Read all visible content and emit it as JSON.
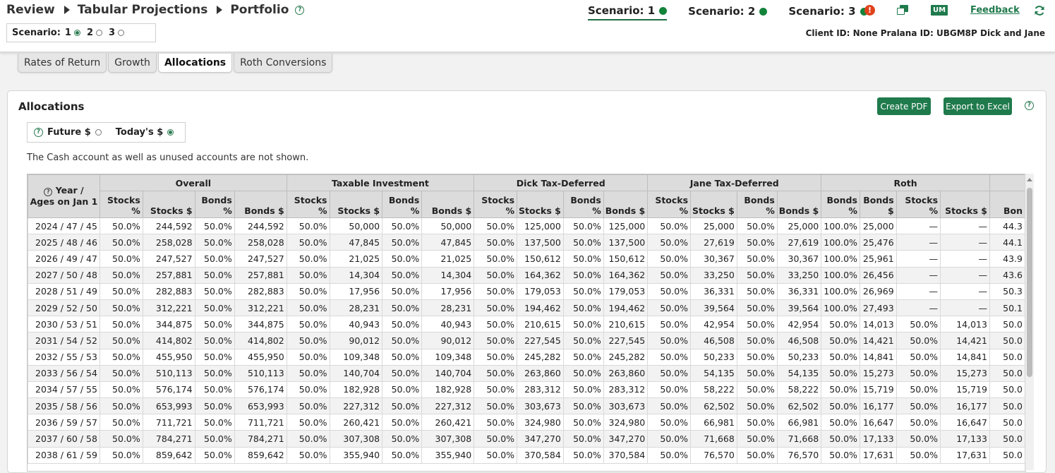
{
  "breadcrumb": {
    "items": [
      "Review",
      "Tabular Projections",
      "Portfolio"
    ]
  },
  "scenario_select": {
    "label": "Scenario:",
    "options": [
      "1",
      "2",
      "3"
    ],
    "selected": "1"
  },
  "scenario_tabs": [
    {
      "label": "Scenario: 1",
      "status_color": "#13843a",
      "active": true
    },
    {
      "label": "Scenario: 2",
      "status_color": "#13843a",
      "active": false
    },
    {
      "label": "Scenario: 3",
      "status_color": "#13843a",
      "active": false
    }
  ],
  "header": {
    "alert_glyph": "!",
    "user_badge": "UM",
    "feedback_label": "Feedback",
    "client_info": "Client ID: None  Pralana ID: UBGM8P  Dick and Jane"
  },
  "page_tabs": [
    {
      "label": "Rates of Return",
      "active": false
    },
    {
      "label": "Growth",
      "active": false
    },
    {
      "label": "Allocations",
      "active": true
    },
    {
      "label": "Roth Conversions",
      "active": false
    }
  ],
  "panel": {
    "title": "Allocations",
    "create_pdf_label": "Create PDF",
    "export_label": "Export to Excel",
    "dollar_options": [
      {
        "label": "Future $",
        "selected": false
      },
      {
        "label": "Today's $",
        "selected": true
      }
    ],
    "note": "The Cash account as well as unused accounts are not shown."
  },
  "table": {
    "year_header": [
      "Year /",
      "Ages on Jan 1"
    ],
    "groups": [
      "Overall",
      "Taxable Investment",
      "Dick Tax-Deferred",
      "Jane Tax-Deferred",
      "Roth",
      ""
    ],
    "subheaders": [
      [
        "Stocks",
        "%"
      ],
      [
        "Stocks $"
      ],
      [
        "Bonds",
        "%"
      ],
      [
        "Bonds $"
      ],
      [
        "Stocks",
        "%"
      ],
      [
        "Stocks $"
      ],
      [
        "Bonds",
        "%"
      ],
      [
        "Bonds $"
      ],
      [
        "Stocks",
        "%"
      ],
      [
        "Stocks $"
      ],
      [
        "Bonds",
        "%"
      ],
      [
        "Bonds $"
      ],
      [
        "Stocks",
        "%"
      ],
      [
        "Stocks $"
      ],
      [
        "Bonds",
        "%"
      ],
      [
        "Bonds $"
      ],
      [
        "Bonds",
        "%"
      ],
      [
        "Bonds",
        "$"
      ],
      [
        "Stocks",
        "%"
      ],
      [
        "Stocks $"
      ],
      [
        "Bon"
      ]
    ],
    "rows": [
      [
        "2024 / 47 / 45",
        "50.0%",
        "244,592",
        "50.0%",
        "244,592",
        "50.0%",
        "50,000",
        "50.0%",
        "50,000",
        "50.0%",
        "125,000",
        "50.0%",
        "125,000",
        "50.0%",
        "25,000",
        "50.0%",
        "25,000",
        "100.0%",
        "25,000",
        "—",
        "—",
        "44.3"
      ],
      [
        "2025 / 48 / 46",
        "50.0%",
        "258,028",
        "50.0%",
        "258,028",
        "50.0%",
        "47,845",
        "50.0%",
        "47,845",
        "50.0%",
        "137,500",
        "50.0%",
        "137,500",
        "50.0%",
        "27,619",
        "50.0%",
        "27,619",
        "100.0%",
        "25,476",
        "—",
        "—",
        "44.1"
      ],
      [
        "2026 / 49 / 47",
        "50.0%",
        "247,527",
        "50.0%",
        "247,527",
        "50.0%",
        "21,025",
        "50.0%",
        "21,025",
        "50.0%",
        "150,612",
        "50.0%",
        "150,612",
        "50.0%",
        "30,367",
        "50.0%",
        "30,367",
        "100.0%",
        "25,961",
        "—",
        "—",
        "43.9"
      ],
      [
        "2027 / 50 / 48",
        "50.0%",
        "257,881",
        "50.0%",
        "257,881",
        "50.0%",
        "14,304",
        "50.0%",
        "14,304",
        "50.0%",
        "164,362",
        "50.0%",
        "164,362",
        "50.0%",
        "33,250",
        "50.0%",
        "33,250",
        "100.0%",
        "26,456",
        "—",
        "—",
        "43.6"
      ],
      [
        "2028 / 51 / 49",
        "50.0%",
        "282,883",
        "50.0%",
        "282,883",
        "50.0%",
        "17,956",
        "50.0%",
        "17,956",
        "50.0%",
        "179,053",
        "50.0%",
        "179,053",
        "50.0%",
        "36,331",
        "50.0%",
        "36,331",
        "100.0%",
        "26,969",
        "—",
        "—",
        "50.3"
      ],
      [
        "2029 / 52 / 50",
        "50.0%",
        "312,221",
        "50.0%",
        "312,221",
        "50.0%",
        "28,231",
        "50.0%",
        "28,231",
        "50.0%",
        "194,462",
        "50.0%",
        "194,462",
        "50.0%",
        "39,564",
        "50.0%",
        "39,564",
        "100.0%",
        "27,493",
        "—",
        "—",
        "50.1"
      ],
      [
        "2030 / 53 / 51",
        "50.0%",
        "344,875",
        "50.0%",
        "344,875",
        "50.0%",
        "40,943",
        "50.0%",
        "40,943",
        "50.0%",
        "210,615",
        "50.0%",
        "210,615",
        "50.0%",
        "42,954",
        "50.0%",
        "42,954",
        "50.0%",
        "14,013",
        "50.0%",
        "14,013",
        "50.0"
      ],
      [
        "2031 / 54 / 52",
        "50.0%",
        "414,802",
        "50.0%",
        "414,802",
        "50.0%",
        "90,012",
        "50.0%",
        "90,012",
        "50.0%",
        "227,545",
        "50.0%",
        "227,545",
        "50.0%",
        "46,508",
        "50.0%",
        "46,508",
        "50.0%",
        "14,421",
        "50.0%",
        "14,421",
        "50.0"
      ],
      [
        "2032 / 55 / 53",
        "50.0%",
        "455,950",
        "50.0%",
        "455,950",
        "50.0%",
        "109,348",
        "50.0%",
        "109,348",
        "50.0%",
        "245,282",
        "50.0%",
        "245,282",
        "50.0%",
        "50,233",
        "50.0%",
        "50,233",
        "50.0%",
        "14,841",
        "50.0%",
        "14,841",
        "50.0"
      ],
      [
        "2033 / 56 / 54",
        "50.0%",
        "510,113",
        "50.0%",
        "510,113",
        "50.0%",
        "140,704",
        "50.0%",
        "140,704",
        "50.0%",
        "263,860",
        "50.0%",
        "263,860",
        "50.0%",
        "54,135",
        "50.0%",
        "54,135",
        "50.0%",
        "15,273",
        "50.0%",
        "15,273",
        "50.0"
      ],
      [
        "2034 / 57 / 55",
        "50.0%",
        "576,174",
        "50.0%",
        "576,174",
        "50.0%",
        "182,928",
        "50.0%",
        "182,928",
        "50.0%",
        "283,312",
        "50.0%",
        "283,312",
        "50.0%",
        "58,222",
        "50.0%",
        "58,222",
        "50.0%",
        "15,719",
        "50.0%",
        "15,719",
        "50.0"
      ],
      [
        "2035 / 58 / 56",
        "50.0%",
        "653,993",
        "50.0%",
        "653,993",
        "50.0%",
        "227,312",
        "50.0%",
        "227,312",
        "50.0%",
        "303,673",
        "50.0%",
        "303,673",
        "50.0%",
        "62,502",
        "50.0%",
        "62,502",
        "50.0%",
        "16,177",
        "50.0%",
        "16,177",
        "50.0"
      ],
      [
        "2036 / 59 / 57",
        "50.0%",
        "711,721",
        "50.0%",
        "711,721",
        "50.0%",
        "260,421",
        "50.0%",
        "260,421",
        "50.0%",
        "324,980",
        "50.0%",
        "324,980",
        "50.0%",
        "66,981",
        "50.0%",
        "66,981",
        "50.0%",
        "16,647",
        "50.0%",
        "16,647",
        "50.0"
      ],
      [
        "2037 / 60 / 58",
        "50.0%",
        "784,271",
        "50.0%",
        "784,271",
        "50.0%",
        "307,308",
        "50.0%",
        "307,308",
        "50.0%",
        "347,270",
        "50.0%",
        "347,270",
        "50.0%",
        "71,668",
        "50.0%",
        "71,668",
        "50.0%",
        "17,133",
        "50.0%",
        "17,133",
        "50.0"
      ],
      [
        "2038 / 61 / 59",
        "50.0%",
        "859,642",
        "50.0%",
        "859,642",
        "50.0%",
        "355,940",
        "50.0%",
        "355,940",
        "50.0%",
        "370,584",
        "50.0%",
        "370,584",
        "50.0%",
        "76,570",
        "50.0%",
        "76,570",
        "50.0%",
        "17,631",
        "50.0%",
        "17,631",
        "50.0"
      ]
    ]
  }
}
